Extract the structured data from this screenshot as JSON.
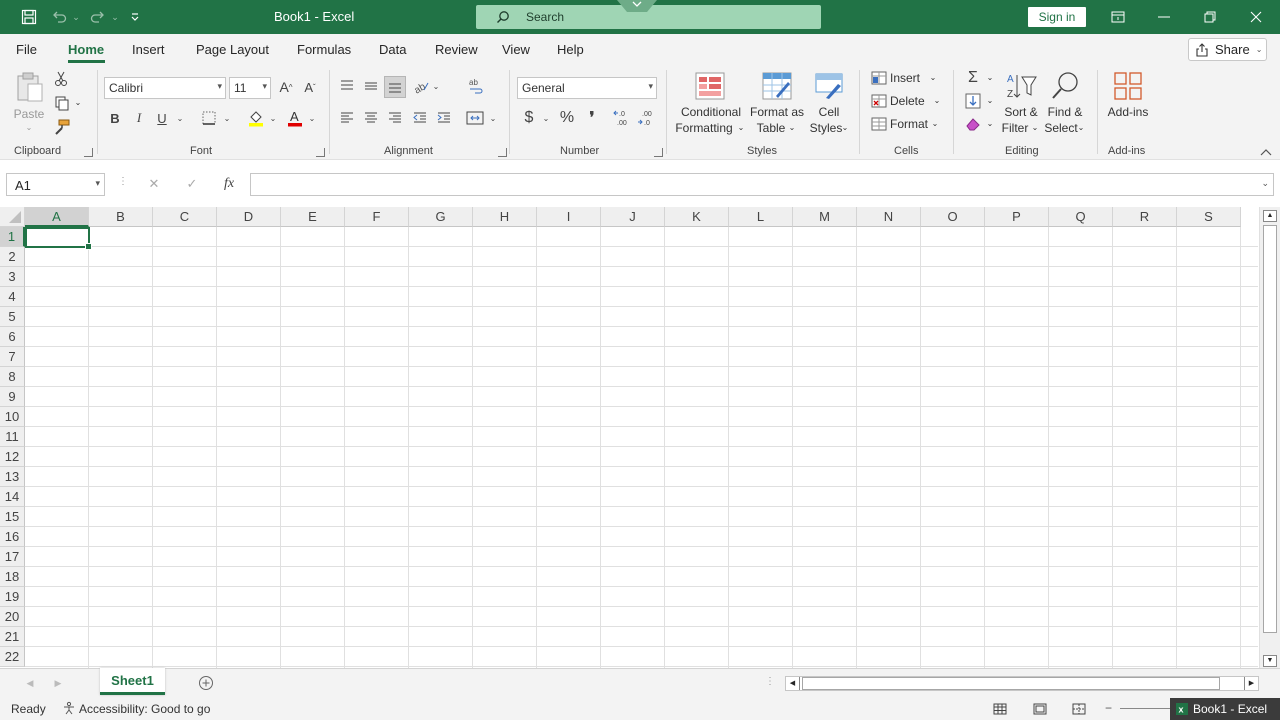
{
  "app": {
    "title": "Book1  -  Excel",
    "search_placeholder": "Search",
    "signin_label": "Sign in",
    "accent_color": "#217346"
  },
  "quick_access": [
    "save-icon",
    "undo-icon",
    "redo-icon",
    "customize-icon"
  ],
  "menu": {
    "tabs": [
      "File",
      "Home",
      "Insert",
      "Page Layout",
      "Formulas",
      "Data",
      "Review",
      "View",
      "Help"
    ],
    "active_tab": "Home",
    "share_label": "Share"
  },
  "ribbon": {
    "groups": {
      "clipboard": "Clipboard",
      "font": "Font",
      "alignment": "Alignment",
      "number": "Number",
      "styles": "Styles",
      "cells": "Cells",
      "editing": "Editing",
      "addins": "Add-ins"
    },
    "paste_label": "Paste",
    "font_name": "Calibri",
    "font_size": "11",
    "bold": "B",
    "italic": "I",
    "underline": "U",
    "number_format": "General",
    "conditional_formatting": [
      "Conditional",
      "Formatting"
    ],
    "format_as_table": [
      "Format as",
      "Table"
    ],
    "cell_styles": [
      "Cell",
      "Styles"
    ],
    "insert_label": "Insert",
    "delete_label": "Delete",
    "format_label": "Format",
    "sort_filter": [
      "Sort &",
      "Filter"
    ],
    "find_select": [
      "Find &",
      "Select"
    ],
    "addins_label": "Add-ins"
  },
  "formula_bar": {
    "name_box": "A1",
    "formula": ""
  },
  "grid": {
    "columns": [
      "A",
      "B",
      "C",
      "D",
      "E",
      "F",
      "G",
      "H",
      "I",
      "J",
      "K",
      "L",
      "M",
      "N",
      "O",
      "P",
      "Q",
      "R",
      "S"
    ],
    "rows": [
      "1",
      "2",
      "3",
      "4",
      "5",
      "6",
      "7",
      "8",
      "9",
      "10",
      "11",
      "12",
      "13",
      "14",
      "15",
      "16",
      "17",
      "18",
      "19",
      "20",
      "21",
      "22"
    ],
    "selected_cell": "A1"
  },
  "sheets": {
    "tabs": [
      "Sheet1"
    ],
    "active": "Sheet1"
  },
  "status": {
    "mode": "Ready",
    "accessibility": "Accessibility: Good to go",
    "taskbar_label": "Book1 - Excel"
  }
}
